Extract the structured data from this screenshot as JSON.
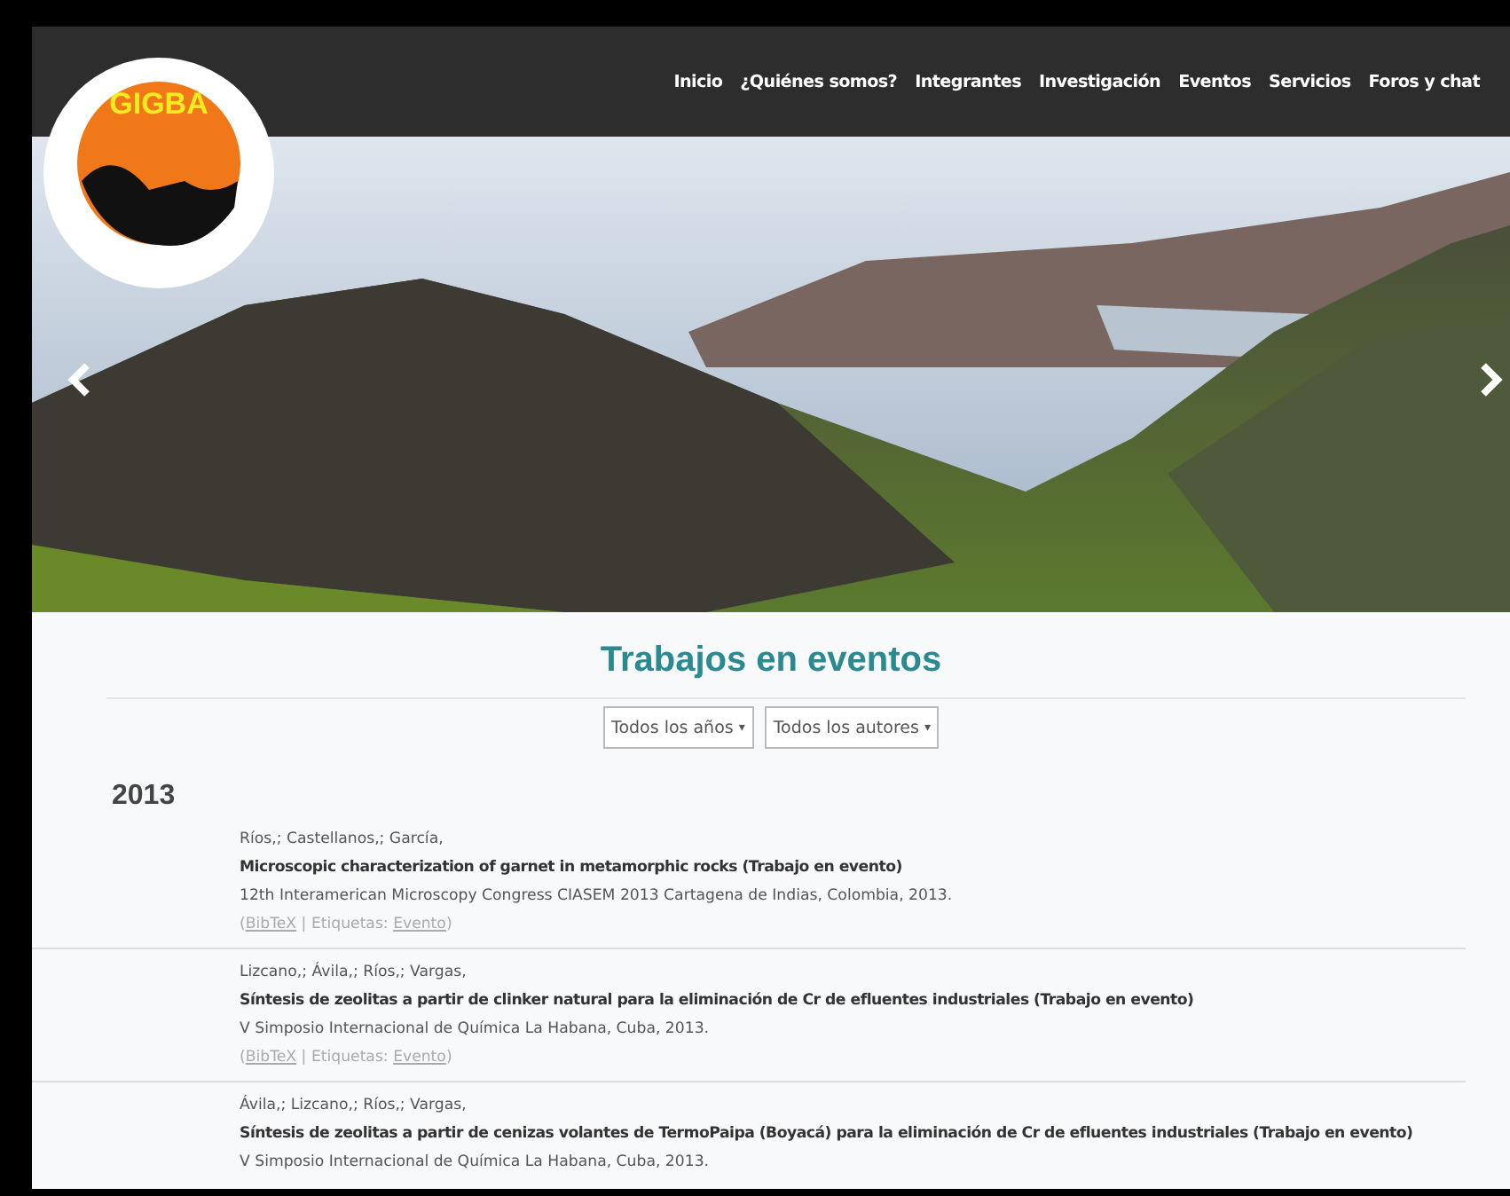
{
  "logo": {
    "text": "GIGBA"
  },
  "nav": [
    {
      "label": "Inicio"
    },
    {
      "label": "¿Quiénes somos?"
    },
    {
      "label": "Integrantes"
    },
    {
      "label": "Investigación"
    },
    {
      "label": "Eventos"
    },
    {
      "label": "Servicios"
    },
    {
      "label": "Foros y chat"
    }
  ],
  "page_title": "Trabajos en eventos",
  "filters": [
    {
      "label": "Todos los años",
      "caret": "▾"
    },
    {
      "label": "Todos los autores",
      "caret": "▾"
    }
  ],
  "year": "2013",
  "entries": [
    {
      "authors": "Ríos,; Castellanos,; García,",
      "title": "Microscopic characterization of garnet in metamorphic rocks (Trabajo en evento)",
      "venue": "12th Interamerican Microscopy Congress CIASEM 2013 Cartagena de Indias, Colombia, 2013.",
      "links": {
        "open": "(",
        "bibtex": "BibTeX",
        "sep": "|",
        "tags_label": "Etiquetas:",
        "tag": "Evento",
        "close": ")"
      }
    },
    {
      "authors": "Lizcano,; Ávila,; Ríos,; Vargas,",
      "title": "Síntesis de zeolitas a partir de clinker natural para la eliminación de Cr de efluentes industriales (Trabajo en evento)",
      "venue": "V Simposio Internacional de Química La Habana, Cuba, 2013.",
      "links": {
        "open": "(",
        "bibtex": "BibTeX",
        "sep": "|",
        "tags_label": "Etiquetas:",
        "tag": "Evento",
        "close": ")"
      }
    },
    {
      "authors": "Ávila,; Lizcano,; Ríos,; Vargas,",
      "title": "Síntesis de zeolitas a partir de cenizas volantes de TermoPaipa (Boyacá) para la eliminación de Cr de efluentes industriales (Trabajo en evento)",
      "venue": "V Simposio Internacional de Química La Habana, Cuba, 2013."
    }
  ]
}
